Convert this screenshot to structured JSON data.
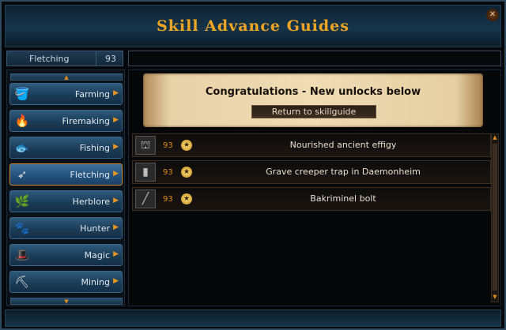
{
  "window": {
    "title": "Skill Advance Guides",
    "close_icon": "close-icon"
  },
  "skill_header": {
    "name": "Fletching",
    "level": "93"
  },
  "sidebar": {
    "items": [
      {
        "label": "Farming",
        "icon": "watering-can-icon",
        "glyph": "🪣",
        "active": false
      },
      {
        "label": "Firemaking",
        "icon": "fire-icon",
        "glyph": "🔥",
        "active": false
      },
      {
        "label": "Fishing",
        "icon": "fish-icon",
        "glyph": "🐟",
        "active": false
      },
      {
        "label": "Fletching",
        "icon": "arrow-icon",
        "glyph": "➶",
        "active": true
      },
      {
        "label": "Herblore",
        "icon": "herb-icon",
        "glyph": "🌿",
        "active": false
      },
      {
        "label": "Hunter",
        "icon": "paw-icon",
        "glyph": "🐾",
        "active": false
      },
      {
        "label": "Magic",
        "icon": "wizard-hat-icon",
        "glyph": "🎩",
        "active": false
      },
      {
        "label": "Mining",
        "icon": "pickaxe-icon",
        "glyph": "⛏",
        "active": false
      }
    ]
  },
  "banner": {
    "title": "Congratulations - New unlocks below",
    "return_label": "Return to skillguide"
  },
  "unlocks": [
    {
      "level": "93",
      "name": "Nourished ancient effigy",
      "icon": "effigy-icon"
    },
    {
      "level": "93",
      "name": "Grave creeper trap in Daemonheim",
      "icon": "trap-icon"
    },
    {
      "level": "93",
      "name": "Bakriminel bolt",
      "icon": "bolt-icon"
    }
  ],
  "colors": {
    "accent": "#f0a623",
    "level": "#e08a1c"
  }
}
